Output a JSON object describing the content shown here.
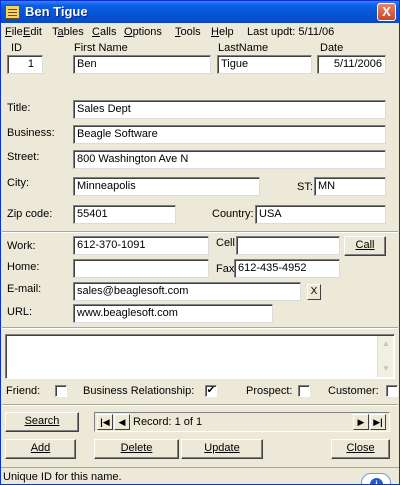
{
  "window": {
    "title": "Ben Tigue",
    "close_glyph": "X"
  },
  "menu": {
    "items": [
      {
        "underline": "F",
        "rest": "ile"
      },
      {
        "underline": "E",
        "rest": "dit"
      },
      {
        "pre": "T",
        "underline": "a",
        "rest": "bles"
      },
      {
        "underline": "C",
        "rest": "alls"
      },
      {
        "underline": "O",
        "rest": "ptions"
      },
      {
        "underline": "T",
        "rest": "ools"
      },
      {
        "underline": "H",
        "rest": "elp"
      }
    ],
    "last_update": "Last updt: 5/11/06"
  },
  "header": {
    "id_label": "ID",
    "id_value": "1",
    "first_name_label": "First Name",
    "first_name": "Ben",
    "last_name_label": "LastName",
    "last_name": "Tigue",
    "date_label": "Date",
    "date": "5/11/2006"
  },
  "address": {
    "title_label": "Title:",
    "title": "Sales Dept",
    "business_label": "Business:",
    "business": "Beagle Software",
    "street_label": "Street:",
    "street": "800 Washington Ave N",
    "city_label": "City:",
    "city": "Minneapolis",
    "state_label": "ST:",
    "state": "MN",
    "zip_label": "Zip code:",
    "zip": "55401",
    "country_label": "Country:",
    "country": "USA"
  },
  "contact": {
    "work_label": "Work:",
    "work": "612-370-1091",
    "cell_label": "Cell:",
    "cell": "",
    "call_button": "Call",
    "home_label": "Home:",
    "home": "",
    "fax_label": "Fax:",
    "fax": "612-435-4952",
    "email_label": "E-mail:",
    "email": "sales@beaglesoft.com",
    "email_clear": "X",
    "url_label": "URL:",
    "url": "www.beaglesoft.com"
  },
  "memo": {
    "text": ""
  },
  "flags": {
    "friend_label": "Friend:",
    "friend": false,
    "business_label": "Business Relationship:",
    "business": true,
    "prospect_label": "Prospect:",
    "prospect": false,
    "customer_label": "Customer:",
    "customer": false,
    "check_glyph": "✔"
  },
  "nav": {
    "search_button": "Search",
    "record_text": "Record: 1 of  1",
    "first_glyph": "|◀",
    "prev_glyph": "◀",
    "next_glyph": "▶",
    "last_glyph": "▶|"
  },
  "actions": {
    "add": "Add",
    "delete": "Delete",
    "update": "Update",
    "close": "Close"
  },
  "status": {
    "text": "Unique ID for this name.",
    "info_glyph": "i"
  }
}
